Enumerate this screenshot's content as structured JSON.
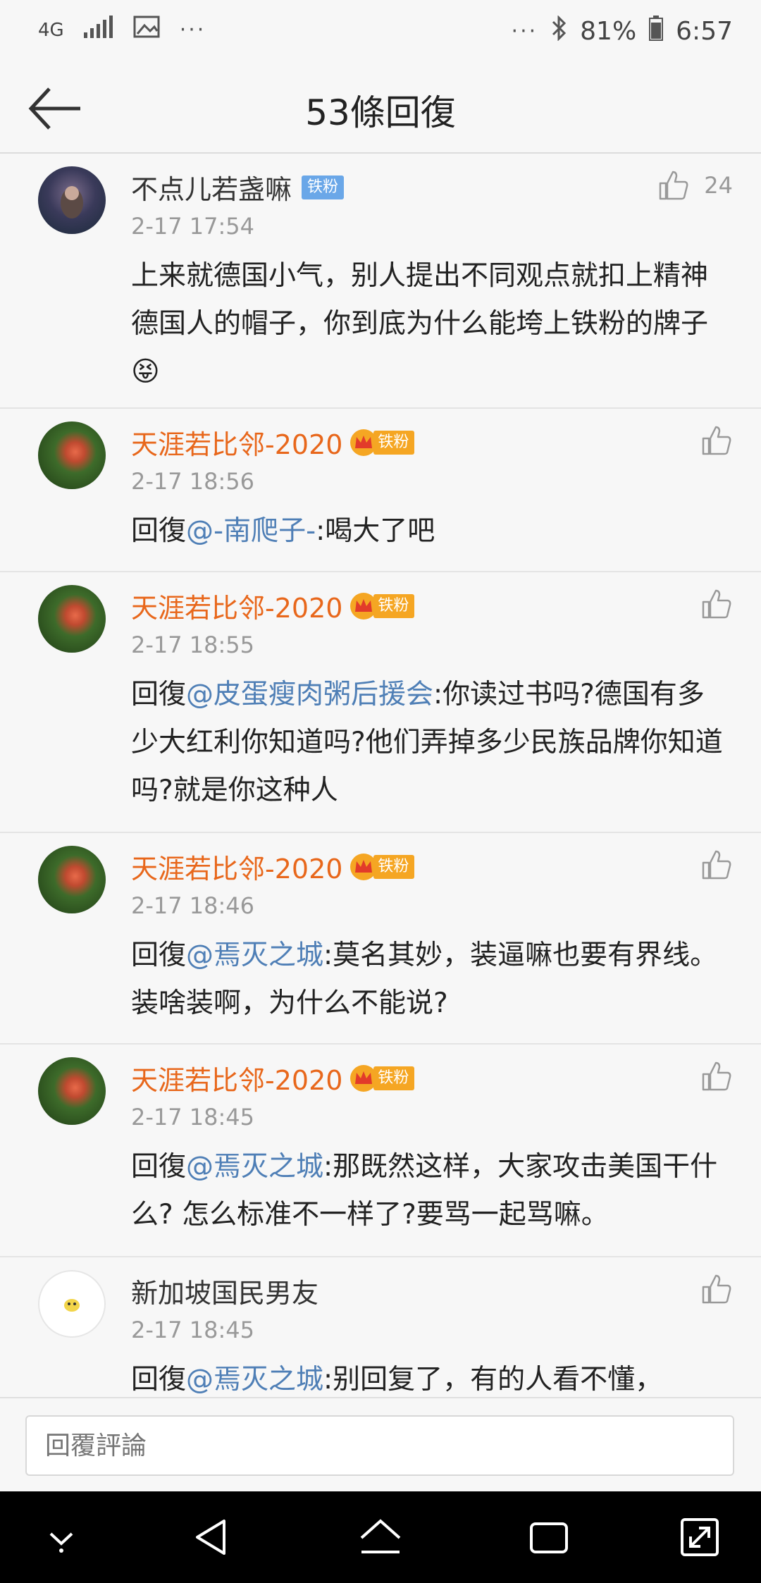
{
  "status_bar": {
    "network": "4G",
    "battery": "81%",
    "time": "6:57",
    "dots_left": "···",
    "dots_right": "···"
  },
  "header": {
    "title": "53條回復"
  },
  "comments": [
    {
      "name": "不点儿若盏嘛",
      "badge": "铁粉",
      "time": "2-17 17:54",
      "likes": "24",
      "content": "上来就德国小气，别人提出不同观点就扣上精神德国人的帽子，你到底为什么能垮上铁粉的牌子",
      "emoji": "😝"
    },
    {
      "name": "天涯若比邻-2020",
      "badge": "铁粉",
      "time": "2-17 18:56",
      "reply_prefix": "回復",
      "mention": "@-南爬子-",
      "content": ":喝大了吧"
    },
    {
      "name": "天涯若比邻-2020",
      "badge": "铁粉",
      "time": "2-17 18:55",
      "reply_prefix": "回復",
      "mention": "@皮蛋瘦肉粥后援会",
      "content": ":你读过书吗?德国有多少大红利你知道吗?他们弄掉多少民族品牌你知道吗?就是你这种人"
    },
    {
      "name": "天涯若比邻-2020",
      "badge": "铁粉",
      "time": "2-17 18:46",
      "reply_prefix": "回復",
      "mention": "@焉灭之城",
      "content": ":莫名其妙，装逼嘛也要有界线。装啥装啊，为什么不能说?"
    },
    {
      "name": "天涯若比邻-2020",
      "badge": "铁粉",
      "time": "2-17 18:45",
      "reply_prefix": "回復",
      "mention": "@焉灭之城",
      "content": ":那既然这样，大家攻击美国干什么? 怎么标准不一样了?要骂一起骂嘛。"
    },
    {
      "name": "新加坡国民男友",
      "time": "2-17 18:45",
      "reply_prefix": "回復",
      "mention": "@焉灭之城",
      "content": ":别回复了，有的人看不懂，"
    }
  ],
  "reply_bar": {
    "placeholder": "回覆評論"
  },
  "colors": {
    "orange_name": "#e8671b",
    "mention": "#4f7fb6",
    "blue_badge": "#6aa7e8",
    "crown_badge": "#f5a623"
  }
}
